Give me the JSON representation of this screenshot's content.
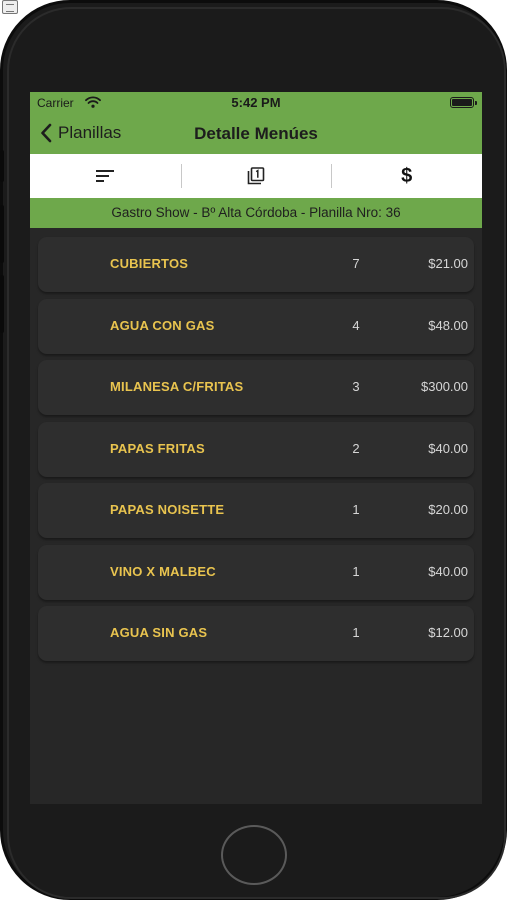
{
  "status_bar": {
    "carrier": "Carrier",
    "time": "5:42 PM"
  },
  "nav": {
    "back_label": "Planillas",
    "title": "Detalle Menúes"
  },
  "toolbar": {
    "sort_icon": "sort-lines-icon",
    "copy_icon": "copy-pages-icon",
    "price_label": "$"
  },
  "subheader": "Gastro Show - Bº Alta Córdoba - Planilla Nro: 36",
  "items": [
    {
      "name": "CUBIERTOS",
      "qty": "7",
      "price": "$21.00"
    },
    {
      "name": "AGUA CON GAS",
      "qty": "4",
      "price": "$48.00"
    },
    {
      "name": "MILANESA C/FRITAS",
      "qty": "3",
      "price": "$300.00"
    },
    {
      "name": "PAPAS FRITAS",
      "qty": "2",
      "price": "$40.00"
    },
    {
      "name": "PAPAS NOISETTE",
      "qty": "1",
      "price": "$20.00"
    },
    {
      "name": "VINO X MALBEC",
      "qty": "1",
      "price": "$40.00"
    },
    {
      "name": "AGUA SIN GAS",
      "qty": "1",
      "price": "$12.00"
    }
  ],
  "colors": {
    "accent_green": "#6ea84b",
    "item_name": "#e9c44f",
    "screen_bg": "#272727",
    "row_bg": "#2e2e2e"
  }
}
